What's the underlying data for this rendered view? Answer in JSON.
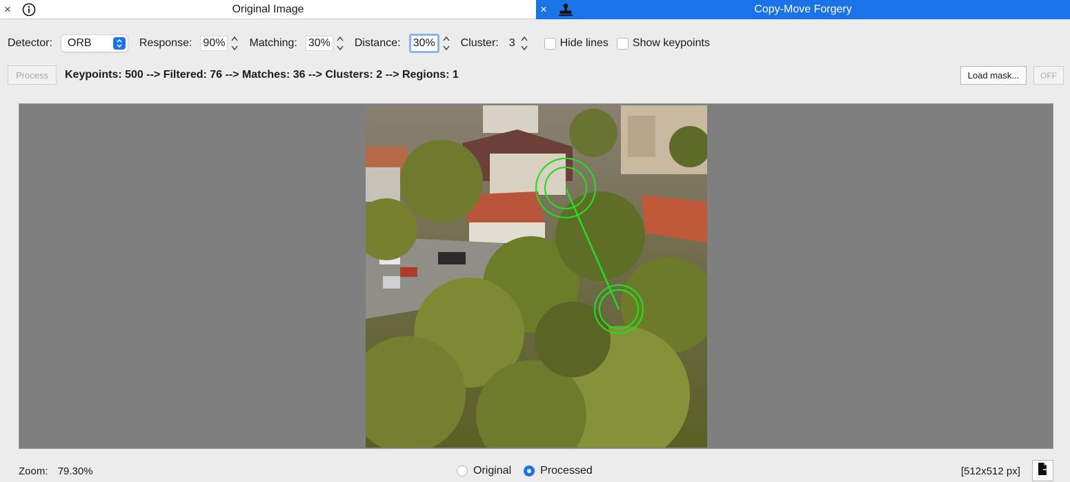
{
  "tabs": {
    "left": {
      "title": "Original Image",
      "close_glyph": "×",
      "icons": [
        "close-icon",
        "info-icon"
      ]
    },
    "right": {
      "title": "Copy-Move Forgery",
      "close_glyph": "×",
      "icons": [
        "close-icon",
        "stamp-icon"
      ],
      "color": "#1a73e8"
    }
  },
  "toolbar": {
    "detector": {
      "label": "Detector:",
      "value": "ORB"
    },
    "response": {
      "label": "Response:",
      "value": "90%"
    },
    "matching": {
      "label": "Matching:",
      "value": "30%"
    },
    "distance": {
      "label": "Distance:",
      "value": "30%"
    },
    "cluster": {
      "label": "Cluster:",
      "value": "3"
    },
    "hide_lines": {
      "label": "Hide lines",
      "checked": false
    },
    "show_keypoints": {
      "label": "Show keypoints",
      "checked": false
    }
  },
  "actions": {
    "process_label": "Process",
    "status": "Keypoints: 500 --> Filtered: 76 --> Matches: 36 --> Clusters: 2 --> Regions: 1",
    "load_mask_label": "Load mask...",
    "off_label": "OFF"
  },
  "viewer": {
    "image_description_icon": "aerial-photo-trees-buildings",
    "match_color": "#22dd22"
  },
  "footer": {
    "zoom_label": "Zoom:",
    "zoom_value": "79.30%",
    "view_options": [
      {
        "label": "Original",
        "selected": false
      },
      {
        "label": "Processed",
        "selected": true
      }
    ],
    "image_size": "[512x512 px]",
    "export_icon": "export-icon"
  },
  "colors": {
    "accent": "#1a73e8",
    "background": "#ececec",
    "viewer_bg": "#7f7f7f"
  }
}
